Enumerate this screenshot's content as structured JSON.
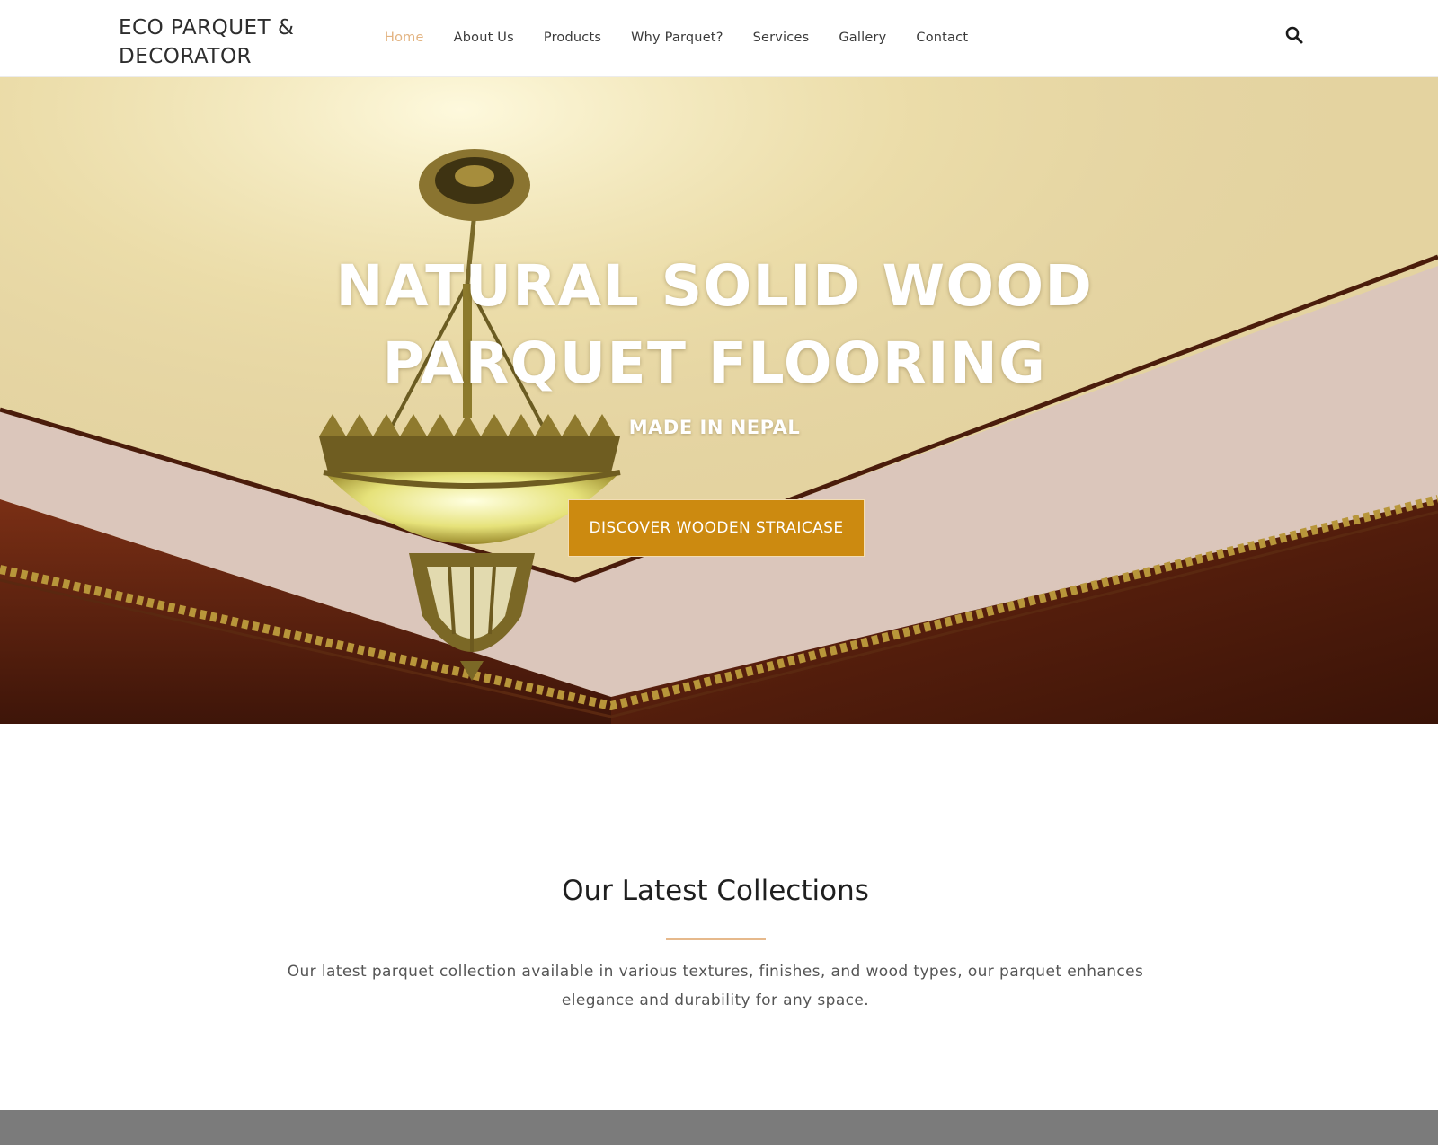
{
  "header": {
    "brand": "ECO PARQUET & DECORATOR",
    "nav": [
      {
        "label": "Home",
        "active": true
      },
      {
        "label": "About Us",
        "active": false
      },
      {
        "label": "Products",
        "active": false
      },
      {
        "label": "Why Parquet?",
        "active": false
      },
      {
        "label": "Services",
        "active": false
      },
      {
        "label": "Gallery",
        "active": false
      },
      {
        "label": "Contact",
        "active": false
      }
    ],
    "search_icon": "search-icon"
  },
  "hero": {
    "title": "NATURAL SOLID WOOD PARQUET FLOORING",
    "subtitle": "MADE IN NEPAL",
    "cta_label": "DISCOVER WOODEN STRAICASE",
    "background_icon": "chandelier-image"
  },
  "collections": {
    "title": "Our Latest Collections",
    "description": "Our latest parquet collection available in various textures, finishes, and wood types, our parquet enhances elegance and durability for any space."
  },
  "colors": {
    "accent": "#cc8a10",
    "nav_active": "#e3b482",
    "divider": "#e6b98c",
    "band": "#7b7b7b"
  }
}
